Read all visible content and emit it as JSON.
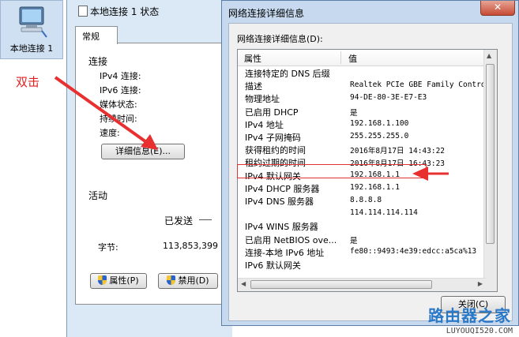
{
  "desktop_icon": {
    "label": "本地连接 1",
    "icon": "network-computer-icon"
  },
  "annotation": {
    "text": "双击",
    "color": "#e02020"
  },
  "status_window": {
    "title": "本地连接 1 状态",
    "tab": "常规",
    "section_connection": "连接",
    "fields": [
      "IPv4 连接:",
      "IPv6 连接:",
      "媒体状态:",
      "持续时间:",
      "速度:"
    ],
    "details_button": "详细信息(E)...",
    "section_activity": "活动",
    "sent_label": "已发送",
    "bytes_label": "字节:",
    "bytes_value": "113,853,399",
    "properties_button": "属性(P)",
    "disable_button": "禁用(D)"
  },
  "details_window": {
    "title": "网络连接详细信息",
    "close_icon": "close-icon",
    "caption": "网络连接详细信息(D):",
    "col_property": "属性",
    "col_value": "值",
    "rows": [
      {
        "k": "连接特定的 DNS 后缀",
        "v": ""
      },
      {
        "k": "描述",
        "v": "Realtek PCIe GBE Family Contro"
      },
      {
        "k": "物理地址",
        "v": "94-DE-80-3E-E7-E3"
      },
      {
        "k": "已启用 DHCP",
        "v": "是"
      },
      {
        "k": "IPv4 地址",
        "v": "192.168.1.100"
      },
      {
        "k": "IPv4 子网掩码",
        "v": "255.255.255.0"
      },
      {
        "k": "获得租约的时间",
        "v": "2016年8月17日 14:43:22"
      },
      {
        "k": "租约过期的时间",
        "v": "2016年8月17日 16:43:23"
      },
      {
        "k": "IPv4 默认网关",
        "v": "192.168.1.1"
      },
      {
        "k": "IPv4 DHCP 服务器",
        "v": "192.168.1.1"
      },
      {
        "k": "IPv4 DNS 服务器",
        "v": "8.8.8.8"
      },
      {
        "k": "",
        "v": "114.114.114.114"
      },
      {
        "k": "IPv4 WINS 服务器",
        "v": ""
      },
      {
        "k": "已启用 NetBIOS ove...",
        "v": "是"
      },
      {
        "k": "连接-本地 IPv6 地址",
        "v": "fe80::9493:4e39:edcc:a5ca%13"
      },
      {
        "k": "IPv6 默认网关",
        "v": ""
      }
    ],
    "close_button": "关闭(C)"
  },
  "watermark": {
    "line1": "路由器之家",
    "line2": "LUYOUQI520.COM"
  }
}
